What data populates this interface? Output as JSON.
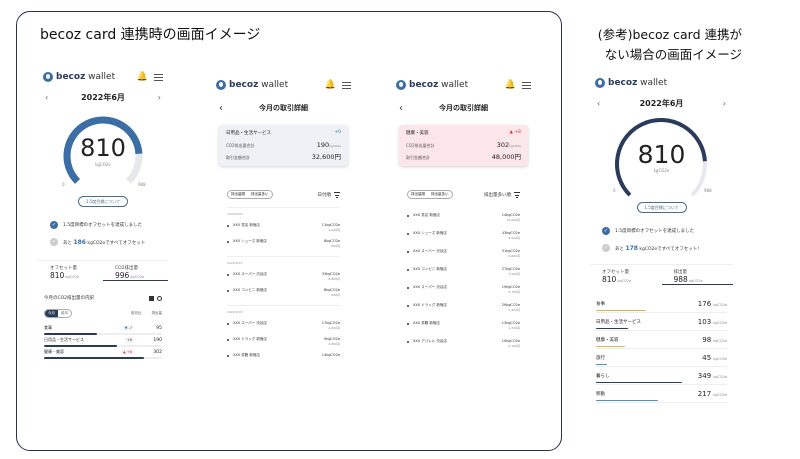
{
  "frame_title": "becoz card 連携時の画面イメージ",
  "ref_title_line1": "(参考)becoz card 連携が",
  "ref_title_line2": "ない場合の画面イメージ",
  "colors": {
    "brand": "#2b3b5c",
    "accent": "#3a6ea5",
    "up": "#d33333",
    "gray": "#cccccc"
  },
  "app": {
    "logo_bold": "becoz",
    "logo_rest": " wallet"
  },
  "home": {
    "month": "2022年6月",
    "gauge_value": "810",
    "gauge_unit": "kgCO2e",
    "gauge_min": "0",
    "gauge_max": "988",
    "gauge_fraction": 0.82,
    "button_label": "1.5度目標について",
    "check1": "1.5度目標のオフセットを達成しました",
    "check2_pre": "あと",
    "check2_num": "186",
    "check2_post": "kgCO2eですべてオフセット",
    "offset_label": "オフセット量",
    "offset_value": "810",
    "emission_label": "CO2排出量",
    "emission_value": "996",
    "unit_small": "kgCO2e",
    "section_title": "今月のCO2排出量の内訳",
    "toggle_a": "今月",
    "toggle_b": "前月",
    "col_a": "前月比",
    "col_b": "排出量",
    "categories": [
      {
        "name": "食事",
        "delta": "▼ -7",
        "dir": "down",
        "amount": "95",
        "level": 0.45,
        "color": "#2b3b5c"
      },
      {
        "name": "日用品・生活サービス",
        "delta": "+0",
        "dir": "flat",
        "amount": "190",
        "level": 0.62,
        "color": "#2b3b5c"
      },
      {
        "name": "健康・美容",
        "delta": "▲ +8",
        "dir": "up",
        "amount": "302",
        "level": 0.85,
        "color": "#2b3b5c"
      }
    ]
  },
  "detail": {
    "title": "今月の取引詳細",
    "card_label1": "CO2排出量合計",
    "card_label2": "取引金額合計",
    "toggle_a": "排出量順",
    "toggle_b": "排出量多い",
    "sort_label": "日付順",
    "sort_label_b": "排出量多い順",
    "left": {
      "category": "日用品・生活サービス",
      "delta": "+0",
      "co2": "190",
      "amount": "32,600円",
      "groups": [
        {
          "date": "2022/6/26",
          "items": [
            {
              "name": "XXX 書店 新宿店",
              "co2": "11kgCO2e",
              "yen": "2,000円"
            },
            {
              "name": "XXX シューズ 新宿店",
              "co2": "8kgCO2e",
              "yen": "800円"
            }
          ]
        },
        {
          "date": "2022/6/23",
          "items": [
            {
              "name": "XXX スーパー 渋谷店",
              "co2": "33kgCO2e",
              "yen": "8,800円"
            },
            {
              "name": "XXX コンビニ 新宿店",
              "co2": "8kgCO2e",
              "yen": "500円"
            }
          ]
        },
        {
          "date": "2022/6/18",
          "items": [
            {
              "name": "XXX スーパー 渋谷店",
              "co2": "17kgCO2e",
              "yen": "4,900円"
            },
            {
              "name": "XXX ドラッグ 新宿店",
              "co2": "9kgCO2e",
              "yen": "2,800円"
            },
            {
              "name": "XXX 書籍 新宿店",
              "co2": "14kgCO2e",
              "yen": ""
            }
          ]
        }
      ]
    },
    "right": {
      "category": "健康・美容",
      "delta": "▲ +8",
      "co2": "302",
      "amount": "48,000円",
      "items": [
        {
          "name": "XXX 書店 新宿店",
          "co2": "14kgCO2e",
          "yen": "15,000円"
        },
        {
          "name": "XXX シューズ 新宿店",
          "co2": "43kgCO2e",
          "yen": "8,500円"
        },
        {
          "name": "XXX スーパー 渋谷店",
          "co2": "31kgCO2e",
          "yen": "6,600円"
        },
        {
          "name": "XXX コンビニ 新宿店",
          "co2": "27kgCO2e",
          "yen": "7,500円"
        },
        {
          "name": "XXX スーパー 渋谷店",
          "co2": "19kgCO2e",
          "yen": "6,700円"
        },
        {
          "name": "XXX ドラッグ 新宿店",
          "co2": "29kgCO2e",
          "yen": "4,300円"
        },
        {
          "name": "XXX 書籍 新宿店",
          "co2": "13kgCO2e",
          "yen": "1,700円"
        },
        {
          "name": "XXX アパレル 渋谷店",
          "co2": "10kgCO2e",
          "yen": "6,100円"
        }
      ]
    }
  },
  "ref": {
    "month": "2022年6月",
    "gauge_value": "810",
    "gauge_unit": "kgCO2e",
    "gauge_min": "0",
    "gauge_max": "988",
    "gauge_fraction": 0.82,
    "button_label": "1.5度目標について",
    "check1": "1.5度目標のオフセットを達成しました",
    "check2_pre": "あと",
    "check2_num": "178",
    "check2_post": "kgCO2eですべてオフセット！",
    "offset_label": "オフセット量",
    "offset_value": "810",
    "emission_label": "排出量",
    "emission_value": "988",
    "unit_small": "kgCO2e",
    "items": [
      {
        "name": "食事",
        "value": "176",
        "level": 0.55,
        "color": "#e0b341"
      },
      {
        "name": "日用品・生活サービス",
        "value": "103",
        "level": 0.35,
        "color": "#2b3b5c"
      },
      {
        "name": "健康・美容",
        "value": "98",
        "level": 0.32,
        "color": "#e0b341"
      },
      {
        "name": "旅行",
        "value": "45",
        "level": 0.12,
        "color": "#4a90c2"
      },
      {
        "name": "暮らし",
        "value": "349",
        "level": 0.95,
        "color": "#2b3b5c"
      },
      {
        "name": "移動",
        "value": "217",
        "level": 0.68,
        "color": "#4a90c2"
      }
    ]
  }
}
